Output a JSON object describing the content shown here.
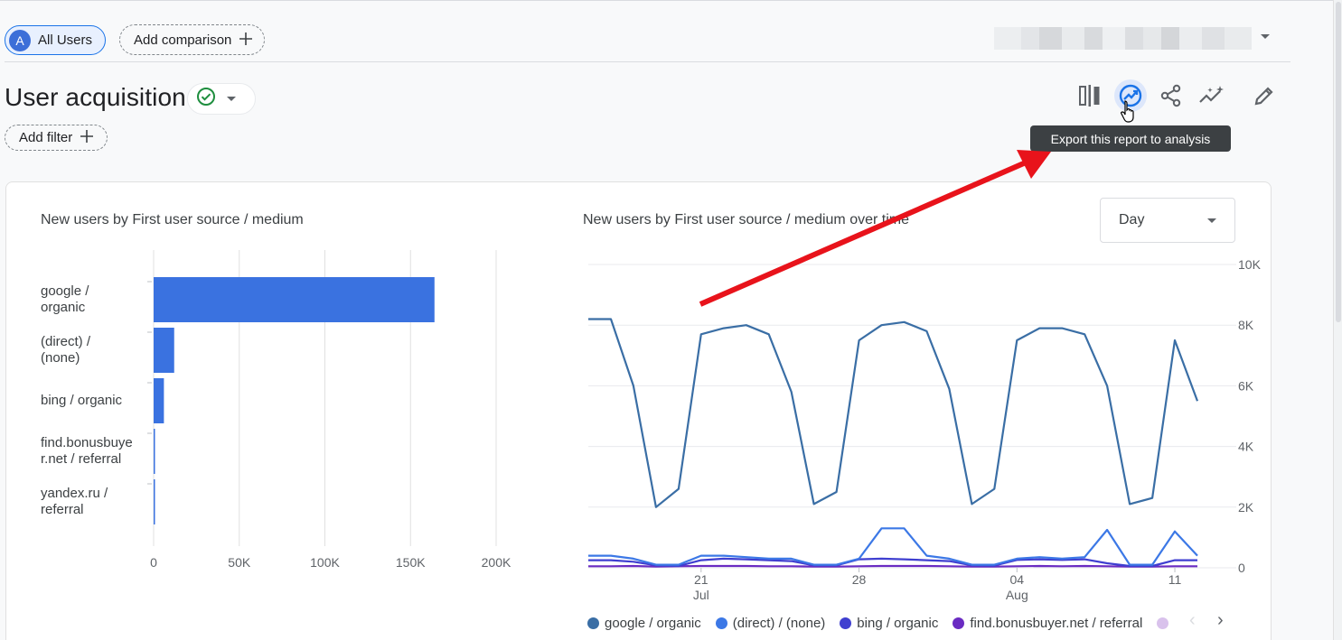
{
  "segment": {
    "avatar_letter": "A",
    "label": "All Users"
  },
  "add_comparison": {
    "label": "Add comparison"
  },
  "report": {
    "title": "User acquisition",
    "status_icon": "check-circle-icon"
  },
  "add_filter": {
    "label": "Add filter"
  },
  "toolbar": {
    "icons": [
      "compare-icon",
      "insights-export-icon",
      "share-icon",
      "sparkle-insights-icon",
      "pencil-icon"
    ],
    "tooltip": "Export this report to analysis"
  },
  "bar_card": {
    "title": "New users by First user source / medium"
  },
  "line_card": {
    "title": "New users by First user source / medium over time",
    "granularity": "Day"
  },
  "colors": {
    "accent": "#1a73e8",
    "bar": "#3a72e0",
    "annotation_arrow": "#e8131b"
  },
  "chart_data": [
    {
      "type": "bar",
      "title": "New users by First user source / medium",
      "orientation": "horizontal",
      "categories": [
        "google / organic",
        "(direct) / (none)",
        "bing / organic",
        "find.bonusbuyer.net / referral",
        "yandex.ru / referral"
      ],
      "category_labels": [
        [
          "google /",
          "organic"
        ],
        [
          "(direct) /",
          "(none)"
        ],
        [
          "bing / organic"
        ],
        [
          "find.bonusbuye",
          "r.net / referral"
        ],
        [
          "yandex.ru /",
          "referral"
        ]
      ],
      "values": [
        164000,
        12000,
        6000,
        400,
        300
      ],
      "xlim": [
        0,
        200000
      ],
      "xticks": [
        "0",
        "50K",
        "100K",
        "150K",
        "200K"
      ],
      "grid": true
    },
    {
      "type": "line",
      "title": "New users by First user source / medium over time",
      "ylim": [
        0,
        10000
      ],
      "yticks": [
        "0",
        "2K",
        "4K",
        "6K",
        "8K",
        "10K"
      ],
      "x_tick_labels": [
        {
          "day": "21",
          "month": "Jul"
        },
        {
          "day": "28",
          "month": ""
        },
        {
          "day": "04",
          "month": "Aug"
        },
        {
          "day": "11",
          "month": ""
        }
      ],
      "x_start": "Jul 16",
      "x_days": 30,
      "series": [
        {
          "name": "google / organic",
          "color": "#3a6ea5",
          "values": [
            8200,
            8200,
            6000,
            2000,
            2600,
            7700,
            7900,
            8000,
            7700,
            5800,
            2100,
            2500,
            7500,
            8000,
            8100,
            7800,
            5900,
            2100,
            2600,
            7500,
            7900,
            7900,
            7700,
            6000,
            2100,
            2300,
            7500,
            5500
          ]
        },
        {
          "name": "(direct) / (none)",
          "color": "#3c78e6",
          "values": [
            400,
            400,
            300,
            100,
            100,
            400,
            400,
            350,
            300,
            300,
            100,
            100,
            300,
            1300,
            1300,
            400,
            300,
            100,
            100,
            300,
            350,
            300,
            350,
            1250,
            100,
            100,
            1200,
            400
          ]
        },
        {
          "name": "bing / organic",
          "color": "#3f3fd0",
          "values": [
            250,
            250,
            200,
            80,
            60,
            250,
            300,
            280,
            250,
            220,
            80,
            80,
            280,
            300,
            280,
            250,
            220,
            80,
            70,
            260,
            280,
            260,
            280,
            150,
            60,
            60,
            250,
            250
          ]
        },
        {
          "name": "find.bonusbuyer.net / referral",
          "color": "#6a2bc2",
          "values": [
            50,
            50,
            60,
            40,
            50,
            60,
            60,
            60,
            50,
            50,
            40,
            40,
            50,
            60,
            60,
            60,
            50,
            40,
            40,
            50,
            60,
            50,
            60,
            50,
            40,
            40,
            50,
            50
          ]
        }
      ],
      "legend_placement": "bottom",
      "legend_overflow_color": "#d9c2ec"
    }
  ]
}
